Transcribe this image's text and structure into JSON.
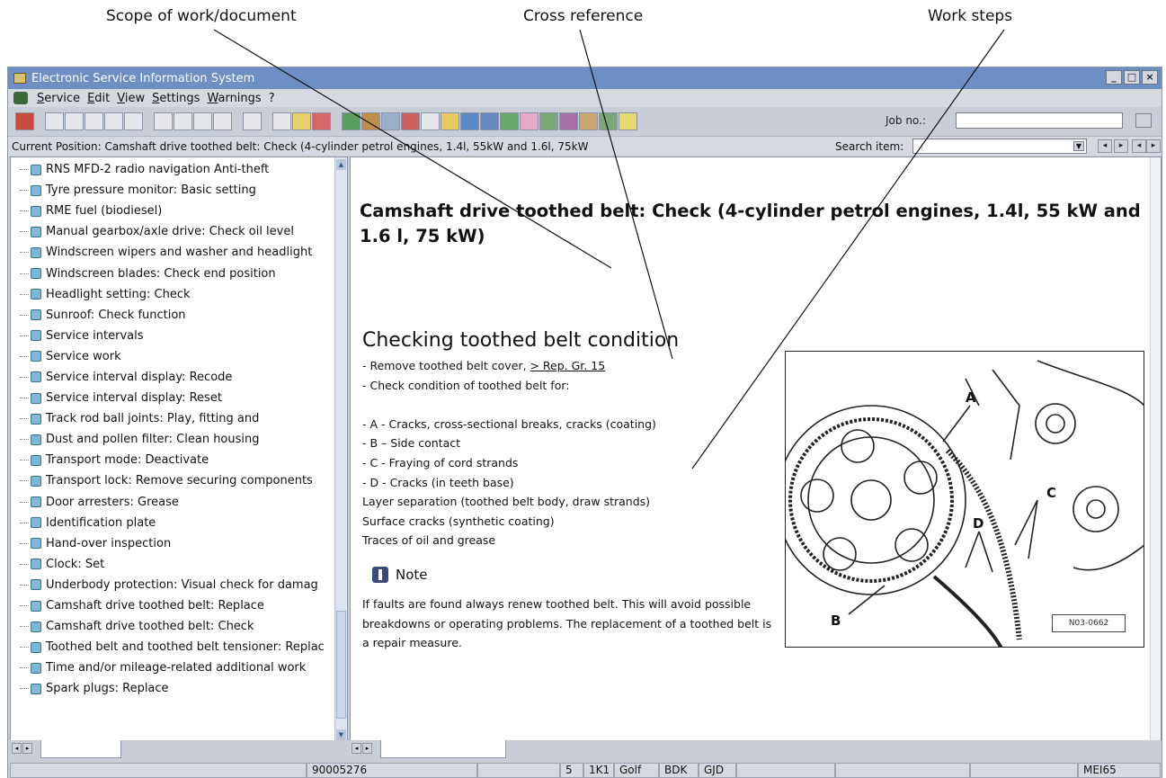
{
  "callouts": {
    "scope": "Scope of work/document",
    "cross_reference": "Cross reference",
    "work_steps": "Work steps"
  },
  "window": {
    "title": "Electronic Service Information System",
    "controls": [
      "_",
      "□",
      "×"
    ]
  },
  "menu": {
    "items": [
      "Service",
      "Edit",
      "View",
      "Settings",
      "Warnings",
      "?"
    ]
  },
  "toolbar": {
    "job_label": "Job no.:",
    "job_value": ""
  },
  "position_bar": {
    "current_position": "Current Position: Camshaft drive toothed belt: Check (4-cylinder petrol engines, 1.4l, 55kW and 1.6l, 75kW",
    "search_label": "Search item:",
    "search_value": ""
  },
  "tree": {
    "items": [
      "RNS MFD-2 radio navigation  Anti-theft",
      "Tyre pressure monitor: Basic setting",
      "RME fuel (biodiesel)",
      "Manual gearbox/axle drive: Check oil level",
      "Windscreen wipers and washer and headlight",
      "Windscreen blades: Check end position",
      "Headlight setting: Check",
      "Sunroof: Check function",
      "Service intervals",
      "Service work",
      "Service interval display: Recode",
      "Service interval display: Reset",
      "Track rod ball joints: Play, fitting and",
      "Dust and pollen filter: Clean housing",
      "Transport mode: Deactivate",
      "Transport lock: Remove securing components",
      "Door arresters: Grease",
      "Identification plate",
      "Hand-over inspection",
      "Clock: Set",
      "Underbody protection: Visual check for damag",
      "Camshaft drive toothed belt: Replace",
      "Camshaft drive toothed belt: Check",
      "Toothed belt and toothed belt tensioner: Replac",
      "Time and/or mileage-related additional work",
      "Spark plugs: Replace"
    ]
  },
  "document": {
    "title": "Camshaft drive toothed belt: Check (4-cylinder petrol engines, 1.4l, 55 kW and 1.6 l, 75 kW)",
    "section_heading": "Checking toothed belt condition",
    "step1_prefix": "- Remove toothed belt cover, ",
    "step1_link": "> Rep. Gr. 15",
    "step2": "- Check condition of toothed belt for:",
    "checks": [
      "- A - Cracks, cross-sectional breaks, cracks (coating)",
      "- B – Side contact",
      "- C - Fraying of cord strands",
      "- D - Cracks (in teeth base)",
      "Layer separation (toothed belt body, draw strands)",
      "Surface cracks (synthetic coating)",
      "Traces of oil and grease"
    ],
    "note_heading": "Note",
    "note_text": "If faults are found always renew toothed belt. This will avoid possible breakdowns or operating problems. The replacement of a toothed belt is a repair measure.",
    "figure": {
      "labels": [
        "A",
        "B",
        "C",
        "D"
      ],
      "code": "N03-0662"
    }
  },
  "status_bar": {
    "doc_number": "90005276",
    "model_fields": [
      "5",
      "1K1",
      "Golf",
      "BDK",
      "GJD"
    ],
    "code": "MEI65"
  }
}
